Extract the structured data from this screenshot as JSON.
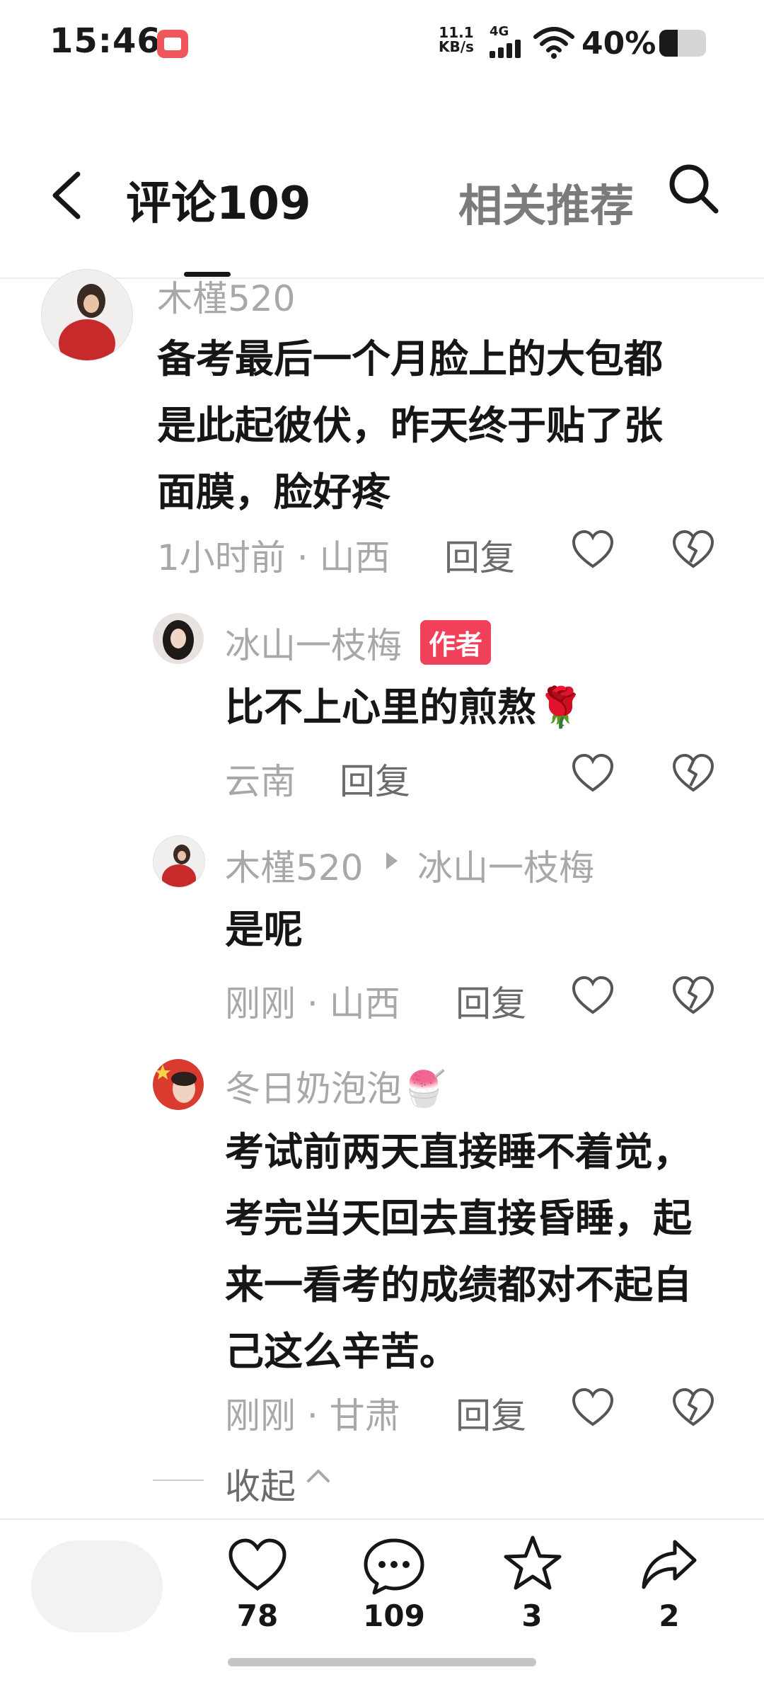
{
  "status_bar": {
    "time": "15:46",
    "net_speed_value": "11.1",
    "net_speed_unit": "KB/s",
    "network_gen": "4G",
    "battery": "40%",
    "battery_level": 0.4
  },
  "header": {
    "tab_comments": "评论109",
    "tab_related": "相关推荐"
  },
  "comments": [
    {
      "author": "木槿520",
      "text": "备考最后一个月脸上的大包都是此起彼伏，昨天终于贴了张面膜，脸好疼",
      "time": "1小时前 · 山西",
      "reply": "回复"
    },
    {
      "author": "冰山一枝梅",
      "badge": "作者",
      "text": "比不上心里的煎熬🌹",
      "time": "云南",
      "reply": "回复"
    },
    {
      "author": "木槿520",
      "reply_to": "冰山一枝梅",
      "text": "是呢",
      "time": "刚刚 · 山西",
      "reply": "回复"
    },
    {
      "author": "冬日奶泡泡🍧",
      "text": "考试前两天直接睡不着觉，考完当天回去直接昏睡，起来一看考的成绩都对不起自己这么辛苦。",
      "time": "刚刚 · 甘肃",
      "reply": "回复"
    }
  ],
  "collapse_label": "收起",
  "bottom_bar": {
    "like_count": "78",
    "comment_count": "109",
    "favorite_count": "3",
    "share_count": "2"
  },
  "colors": {
    "badge": "#f0405a",
    "muted_text": "#a8a8a8",
    "primary_text": "#161616"
  }
}
